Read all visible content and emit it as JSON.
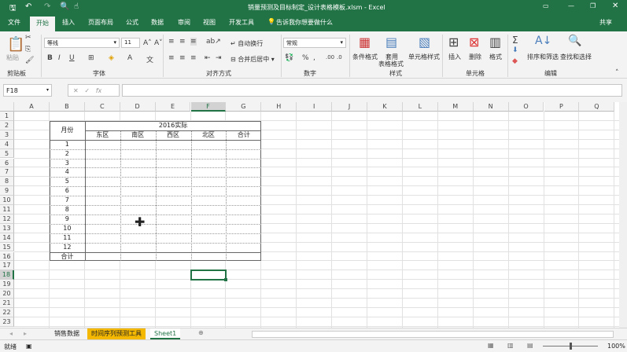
{
  "window": {
    "title": "销量预测及目标制定_设计表格模板.xlsm  -  Excel",
    "share": "共享"
  },
  "tabs": [
    "文件",
    "开始",
    "插入",
    "页面布局",
    "公式",
    "数据",
    "审阅",
    "视图",
    "开发工具"
  ],
  "tell_me": "告诉我你想要做什么",
  "ribbon": {
    "paste": "粘贴",
    "clipboard": "剪贴板",
    "font_name": "等线",
    "font_size": "11",
    "font_group": "字体",
    "wrap": "自动换行",
    "merge": "合并后居中",
    "align_group": "对齐方式",
    "number_format": "常规",
    "number_group": "数字",
    "cond_format": "条件格式",
    "table_format_1": "套用",
    "table_format_2": "表格格式",
    "cell_style": "单元格样式",
    "styles_group": "样式",
    "insert": "插入",
    "delete": "删除",
    "format": "格式",
    "cells_group": "单元格",
    "sort": "排序和筛选",
    "find": "查找和选择",
    "edit_group": "编辑"
  },
  "formula_bar": {
    "name_box": "F18",
    "formula": ""
  },
  "columns": [
    "A",
    "B",
    "C",
    "D",
    "E",
    "F",
    "G",
    "H",
    "I",
    "J",
    "K",
    "L",
    "M",
    "N",
    "O",
    "P",
    "Q"
  ],
  "rows": [
    "1",
    "2",
    "3",
    "4",
    "5",
    "6",
    "7",
    "8",
    "9",
    "10",
    "11",
    "12",
    "13",
    "14",
    "15",
    "16",
    "17",
    "18",
    "19",
    "20",
    "21",
    "22",
    "23"
  ],
  "selected_cell": "F18",
  "table": {
    "month_header": "月份",
    "year_header": "2016实际",
    "regions": [
      "东区",
      "南区",
      "西区",
      "北区",
      "合计"
    ],
    "months": [
      "1",
      "2",
      "3",
      "4",
      "5",
      "6",
      "7",
      "8",
      "9",
      "10",
      "11",
      "12"
    ],
    "total_label": "合计"
  },
  "sheets": [
    {
      "name": "销售数据",
      "color": ""
    },
    {
      "name": "时间序列预测工具",
      "color": "#f5b800"
    },
    {
      "name": "Sheet1",
      "color": "",
      "active": true
    }
  ],
  "status": {
    "ready": "就绪",
    "zoom": "100%"
  },
  "colors": {
    "accent": "#217346"
  }
}
